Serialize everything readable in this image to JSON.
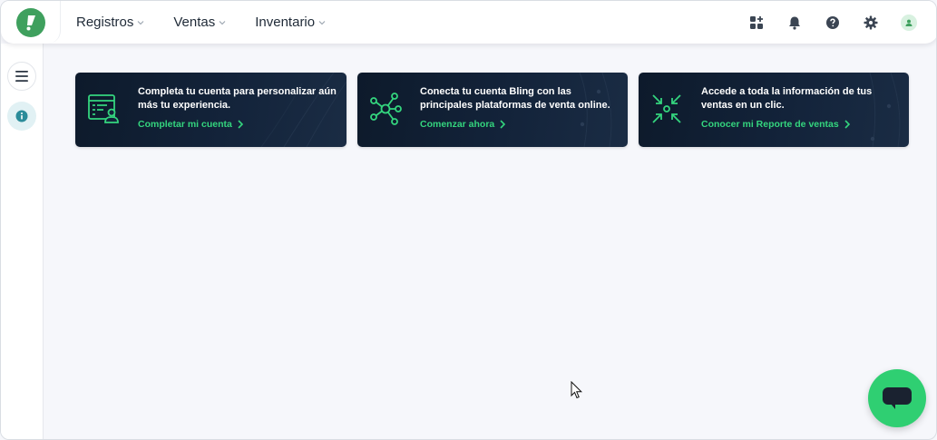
{
  "nav": {
    "items": [
      {
        "label": "Registros"
      },
      {
        "label": "Ventas"
      },
      {
        "label": "Inventario"
      }
    ]
  },
  "header_icons": [
    "apps-icon",
    "bell-icon",
    "help-icon",
    "gear-icon",
    "avatar-icon"
  ],
  "cards": [
    {
      "title": "Completa tu cuenta para personalizar aún más tu experiencia.",
      "cta": "Completar mi cuenta",
      "icon": "account-form-icon"
    },
    {
      "title": "Conecta tu cuenta Bling con las principales plataformas de venta online.",
      "cta": "Comenzar ahora",
      "icon": "network-hub-icon"
    },
    {
      "title": "Accede a toda la información de tus ventas en un clic.",
      "cta": "Conocer mi Reporte de ventas",
      "icon": "collapse-arrows-icon"
    }
  ],
  "colors": {
    "brand_green": "#3fa05e",
    "accent_green": "#34d57e",
    "card_bg": "#0d1a2b",
    "chat_green": "#2fcf72"
  }
}
